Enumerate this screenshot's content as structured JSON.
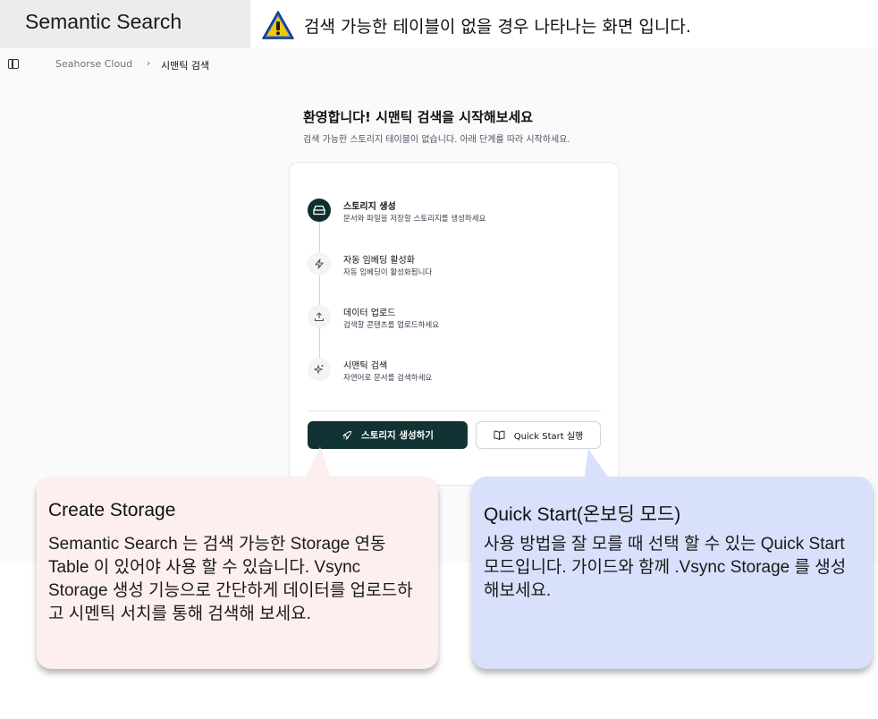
{
  "header": {
    "tab_label": "Semantic Search",
    "note_text": "검색 가능한 테이블이 없을 경우 나타나는 화면 입니다."
  },
  "breadcrumb": {
    "root": "Seahorse Cloud",
    "separator": "›",
    "current": "시맨틱 검색"
  },
  "welcome": {
    "title": "환영합니다! 시맨틱 검색을 시작해보세요",
    "subtitle": "검색 가능한 스토리지 테이블이 없습니다. 아래 단계를 따라 시작하세요."
  },
  "steps": [
    {
      "title": "스토리지 생성",
      "desc": "문서와 파일을 저장할 스토리지를 생성하세요",
      "icon": "storage-icon"
    },
    {
      "title": "자동 임베딩 활성화",
      "desc": "자동 임베딩이 활성화됩니다",
      "icon": "bolt-icon"
    },
    {
      "title": "데이터 업로드",
      "desc": "검색할 콘텐츠를 업로드하세요",
      "icon": "upload-icon"
    },
    {
      "title": "시맨틱 검색",
      "desc": "자연어로 문서를 검색하세요",
      "icon": "sparkle-icon"
    }
  ],
  "buttons": {
    "create_storage": "스토리지 생성하기",
    "quick_start": "Quick Start 실행"
  },
  "callouts": {
    "create": {
      "title": "Create Storage",
      "body": "Semantic Search 는 검색 가능한 Storage 연동 Table 이 있어야 사용 할 수 있습니다. Vsync Storage 생성 기능으로 간단하게 데이터를 업로드하고 시멘틱 서치를 통해 검색해 보세요."
    },
    "quick": {
      "title": "Quick Start(온보딩 모드)",
      "body": "사용 방법을 잘 모를 때 선택 할 수 있는 Quick Start 모드입니다. 가이드와 함께 .Vsync Storage 를 생성해보세요."
    }
  },
  "colors": {
    "primary_dark": "#123333",
    "warning_blue": "#1e5fd6",
    "callout_pink": "#fcefed",
    "callout_blue": "#d8e0fb"
  }
}
